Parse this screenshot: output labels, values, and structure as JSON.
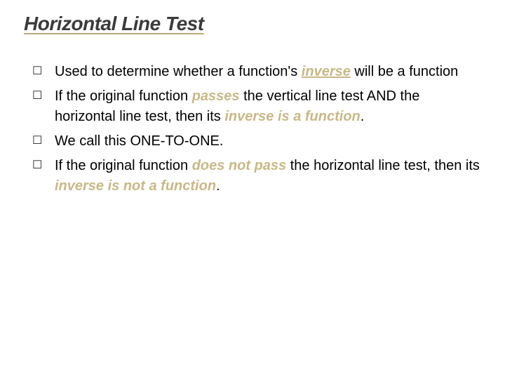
{
  "title": "Horizontal Line Test",
  "bullet": "☐",
  "items": [
    {
      "segments": [
        {
          "t": "Used to determine whether a function's "
        },
        {
          "t": "inverse",
          "cls": "hl-u"
        },
        {
          "t": " will be a function"
        }
      ]
    },
    {
      "segments": [
        {
          "t": "If the original function "
        },
        {
          "t": "passes",
          "cls": "hl"
        },
        {
          "t": " the vertical line test AND the horizontal line test, then its "
        },
        {
          "t": "inverse is a function",
          "cls": "hl"
        },
        {
          "t": "."
        }
      ]
    },
    {
      "segments": [
        {
          "t": "We call this ONE-TO-ONE."
        }
      ]
    },
    {
      "segments": [
        {
          "t": "If the original function "
        },
        {
          "t": "does not pass",
          "cls": "hl"
        },
        {
          "t": " the horizontal line test, then its "
        },
        {
          "t": "inverse is not a function",
          "cls": "hl"
        },
        {
          "t": "."
        }
      ]
    }
  ]
}
